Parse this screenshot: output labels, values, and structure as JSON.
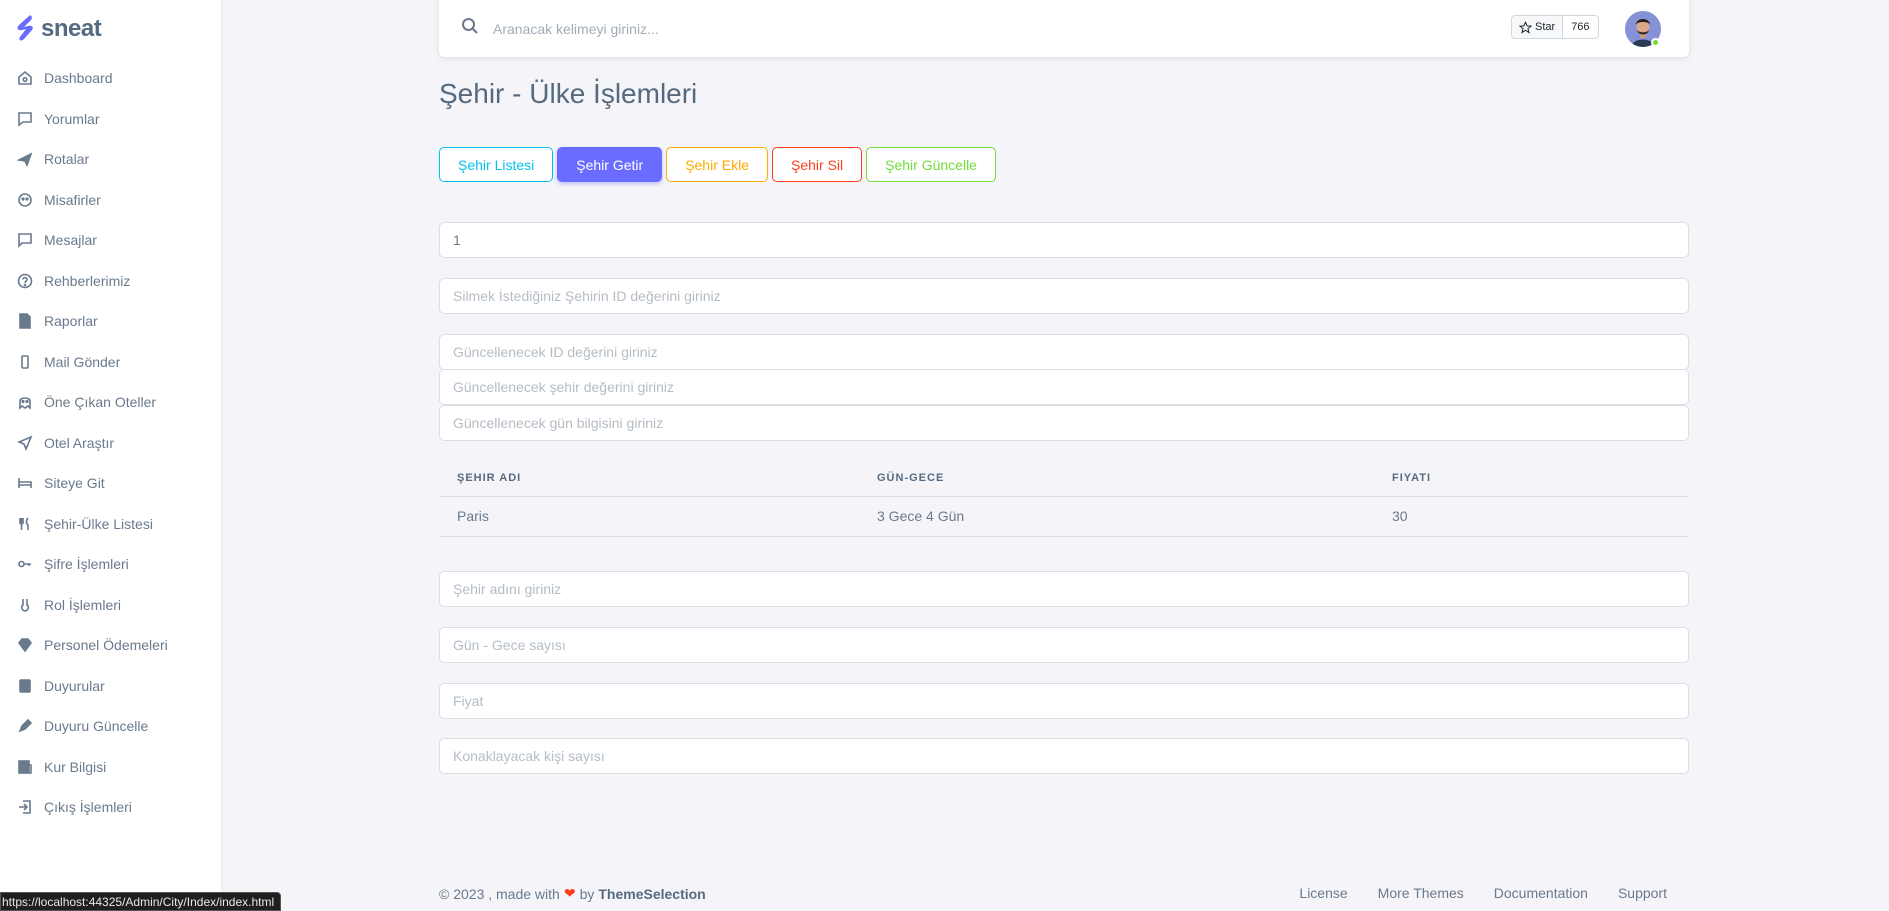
{
  "brand": {
    "name": "sneat"
  },
  "sidebar": {
    "items": [
      {
        "label": "Dashboard",
        "icon": "home-icon"
      },
      {
        "label": "Yorumlar",
        "icon": "message-icon"
      },
      {
        "label": "Rotalar",
        "icon": "plane-icon"
      },
      {
        "label": "Misafirler",
        "icon": "user-icon"
      },
      {
        "label": "Mesajlar",
        "icon": "chat-icon"
      },
      {
        "label": "Rehberlerimiz",
        "icon": "help-icon"
      },
      {
        "label": "Raporlar",
        "icon": "report-icon"
      },
      {
        "label": "Mail Gönder",
        "icon": "mail-icon"
      },
      {
        "label": "Öne Çıkan Oteller",
        "icon": "ghost-icon"
      },
      {
        "label": "Otel Araştır",
        "icon": "send-icon"
      },
      {
        "label": "Siteye Git",
        "icon": "bed-icon"
      },
      {
        "label": "Şehir-Ülke Listesi",
        "icon": "restaurant-icon"
      },
      {
        "label": "Şifre İşlemleri",
        "icon": "key-icon"
      },
      {
        "label": "Rol İşlemleri",
        "icon": "lock-icon"
      },
      {
        "label": "Personel Ödemeleri",
        "icon": "diamond-icon"
      },
      {
        "label": "Duyurular",
        "icon": "book-icon"
      },
      {
        "label": "Duyuru Güncelle",
        "icon": "pen-icon"
      },
      {
        "label": "Kur Bilgisi",
        "icon": "news-icon"
      },
      {
        "label": "Çıkış İşlemleri",
        "icon": "logout-icon"
      }
    ]
  },
  "navbar": {
    "search_placeholder": "Aranacak kelimeyi giriniz...",
    "star_label": "Star",
    "star_count": "766"
  },
  "page": {
    "title": "Şehir - Ülke İşlemleri",
    "buttons": {
      "list": "Şehir Listesi",
      "get": "Şehir Getir",
      "add": "Şehir Ekle",
      "delete": "Şehir Sil",
      "update": "Şehir Güncelle"
    },
    "get_id_value": "1",
    "delete_id_placeholder": "Silmek İstediğiniz Şehirin ID değerini giriniz",
    "update_id_placeholder": "Güncellenecek ID değerini giriniz",
    "update_city_placeholder": "Güncellenecek şehir değerini giriniz",
    "update_day_placeholder": "Güncellenecek gün bilgisini giriniz",
    "table": {
      "headers": [
        "ŞEHIR ADI",
        "GÜN-GECE",
        "FIYATI"
      ],
      "rows": [
        [
          "Paris",
          "3 Gece 4 Gün",
          "30"
        ]
      ]
    },
    "add_city_placeholder": "Şehir adını giriniz",
    "add_daynight_placeholder": "Gün - Gece sayısı",
    "add_price_placeholder": "Fiyat",
    "add_people_placeholder": "Konaklayacak kişi sayısı"
  },
  "footer": {
    "copyright": "© 2023 , made with",
    "by": "by",
    "brand": "ThemeSelection",
    "links": [
      "License",
      "More Themes",
      "Documentation",
      "Support"
    ]
  },
  "status_url": "https://localhost:44325/Admin/City/Index/index.html",
  "colors": {
    "primary": "#696cff",
    "info": "#03c3ec",
    "warning": "#ffab00",
    "danger": "#ff3e1d",
    "success": "#71dd37"
  }
}
